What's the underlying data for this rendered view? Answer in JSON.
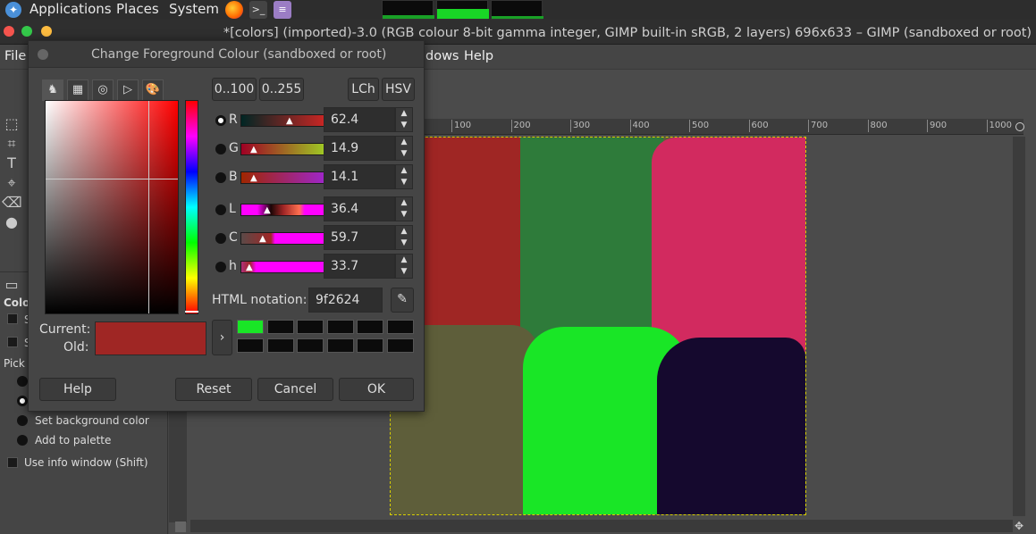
{
  "system_panel": {
    "menus": [
      "Applications",
      "Places",
      "System"
    ]
  },
  "window": {
    "title": "*[colors] (imported)-3.0 (RGB colour 8-bit gamma integer, GIMP built-in sRGB, 2 layers) 696x633 – GIMP (sandboxed or root)"
  },
  "menubar": {
    "file": "File",
    "windows": "dows",
    "help": "Help"
  },
  "ruler_marks": [
    "100",
    "200",
    "300",
    "400",
    "500",
    "600",
    "700",
    "800",
    "900",
    "1000"
  ],
  "toolbox": {
    "tab_label": "Colo",
    "s_label": "S",
    "pick_label": "Pick",
    "set_bg": "Set background color",
    "add_palette": "Add to palette",
    "use_info": "Use info window  (Shift)"
  },
  "dialog": {
    "title": "Change Foreground Colour (sandboxed or root)",
    "range_0_100": "0..100",
    "range_0_255": "0..255",
    "lch": "LCh",
    "hsv": "HSV",
    "channels": [
      {
        "label": "R",
        "value": "62.4"
      },
      {
        "label": "G",
        "value": "14.9"
      },
      {
        "label": "B",
        "value": "14.1"
      },
      {
        "label": "L",
        "value": "36.4"
      },
      {
        "label": "C",
        "value": "59.7"
      },
      {
        "label": "h",
        "value": "33.7"
      }
    ],
    "html_label": "HTML notation:",
    "html_value": "9f2624",
    "current_label": "Current:",
    "old_label": "Old:",
    "help": "Help",
    "reset": "Reset",
    "cancel": "Cancel",
    "ok": "OK",
    "current_color": "#9f2624",
    "history_first": "#19e626"
  }
}
